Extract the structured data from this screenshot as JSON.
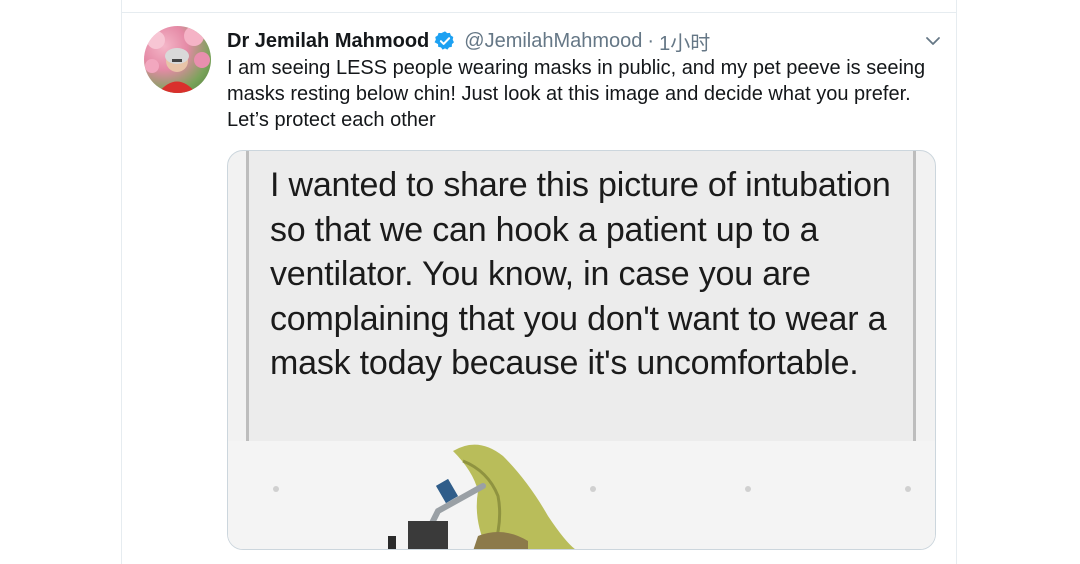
{
  "tweet": {
    "display_name": "Dr Jemilah Mahmood",
    "handle": "@JemilahMahmood",
    "separator": "·",
    "timestamp": "1小时",
    "text": "I am seeing LESS people wearing masks in public, and my pet peeve is seeing masks resting below chin! Just look at this image and decide what you prefer. Let’s protect each other",
    "icons": {
      "verified": "verified-badge-icon",
      "menu": "chevron-down-icon"
    },
    "colors": {
      "verified": "#1da1f2",
      "handle": "#657786",
      "text": "#14171a"
    }
  },
  "media": {
    "embedded_text": "I wanted to share this picture of intubation so that we can hook a patient up to a ventilator. You know, in case you are complaining that you don't want to wear a mask today because it's uncomfortable."
  }
}
